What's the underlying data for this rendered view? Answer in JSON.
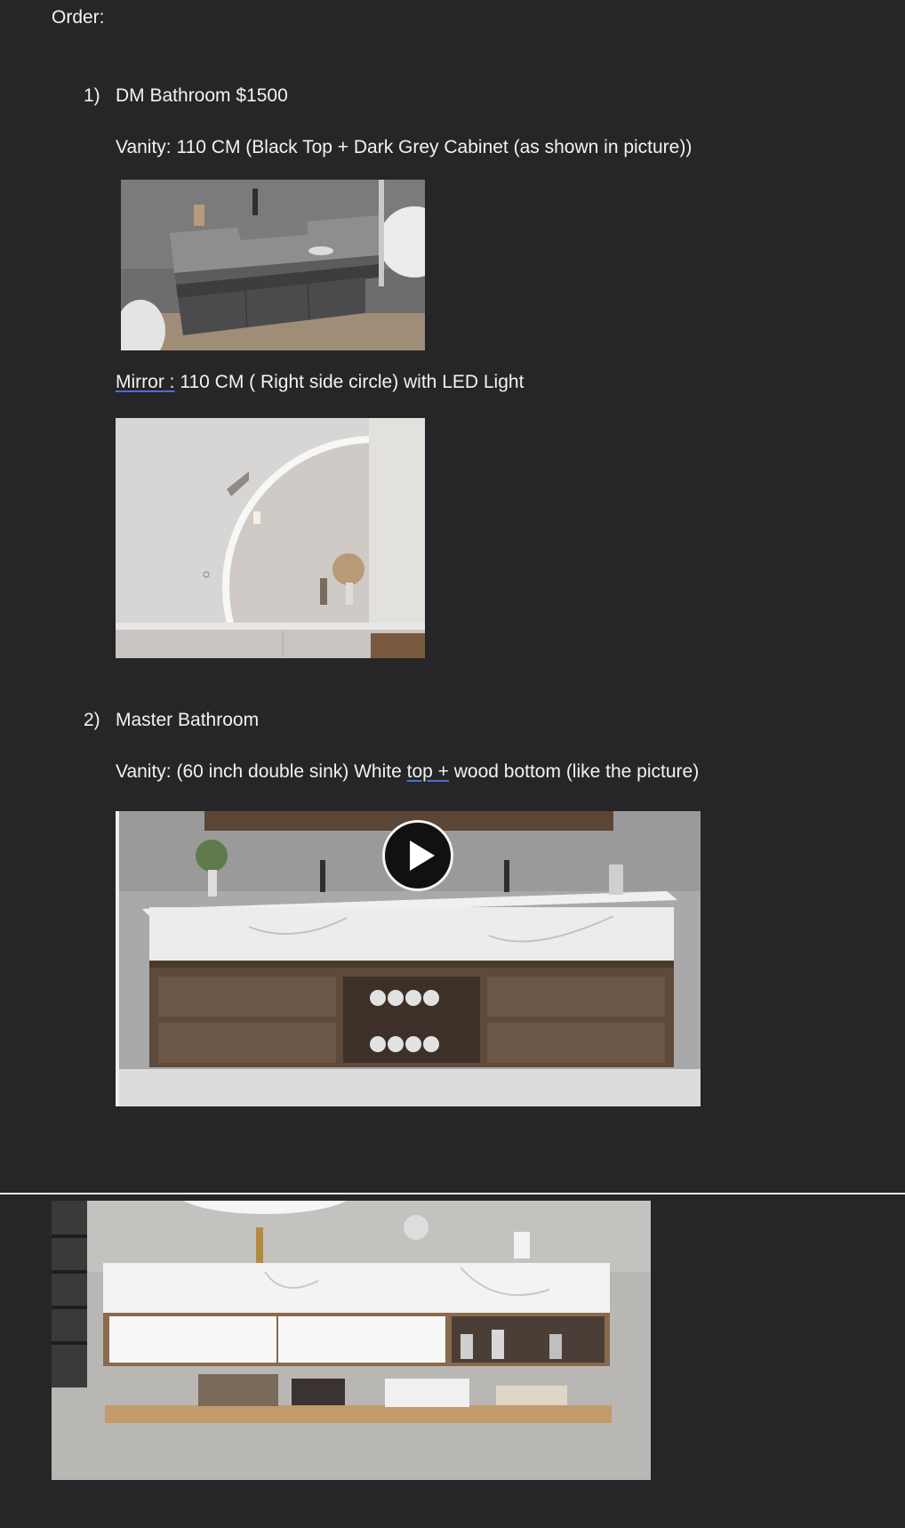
{
  "document": {
    "heading": "Order:",
    "items": [
      {
        "number": "1)",
        "title": "DM Bathroom $1500",
        "vanity_line": "Vanity: 110 CM (Black Top + Dark Grey Cabinet (as shown in picture))",
        "mirror_label": "Mirror :",
        "mirror_rest": " 110 CM ( Right side circle) with LED Light"
      },
      {
        "number": "2)",
        "title": "Master Bathroom",
        "vanity_prefix": "Vanity: (60 inch double sink) White ",
        "vanity_underlined": "top  +",
        "vanity_suffix": " wood bottom (like the picture)"
      }
    ]
  },
  "colors": {
    "background": "#262628",
    "text": "#f2f2f2",
    "link_underline": "#4a6fd6"
  }
}
